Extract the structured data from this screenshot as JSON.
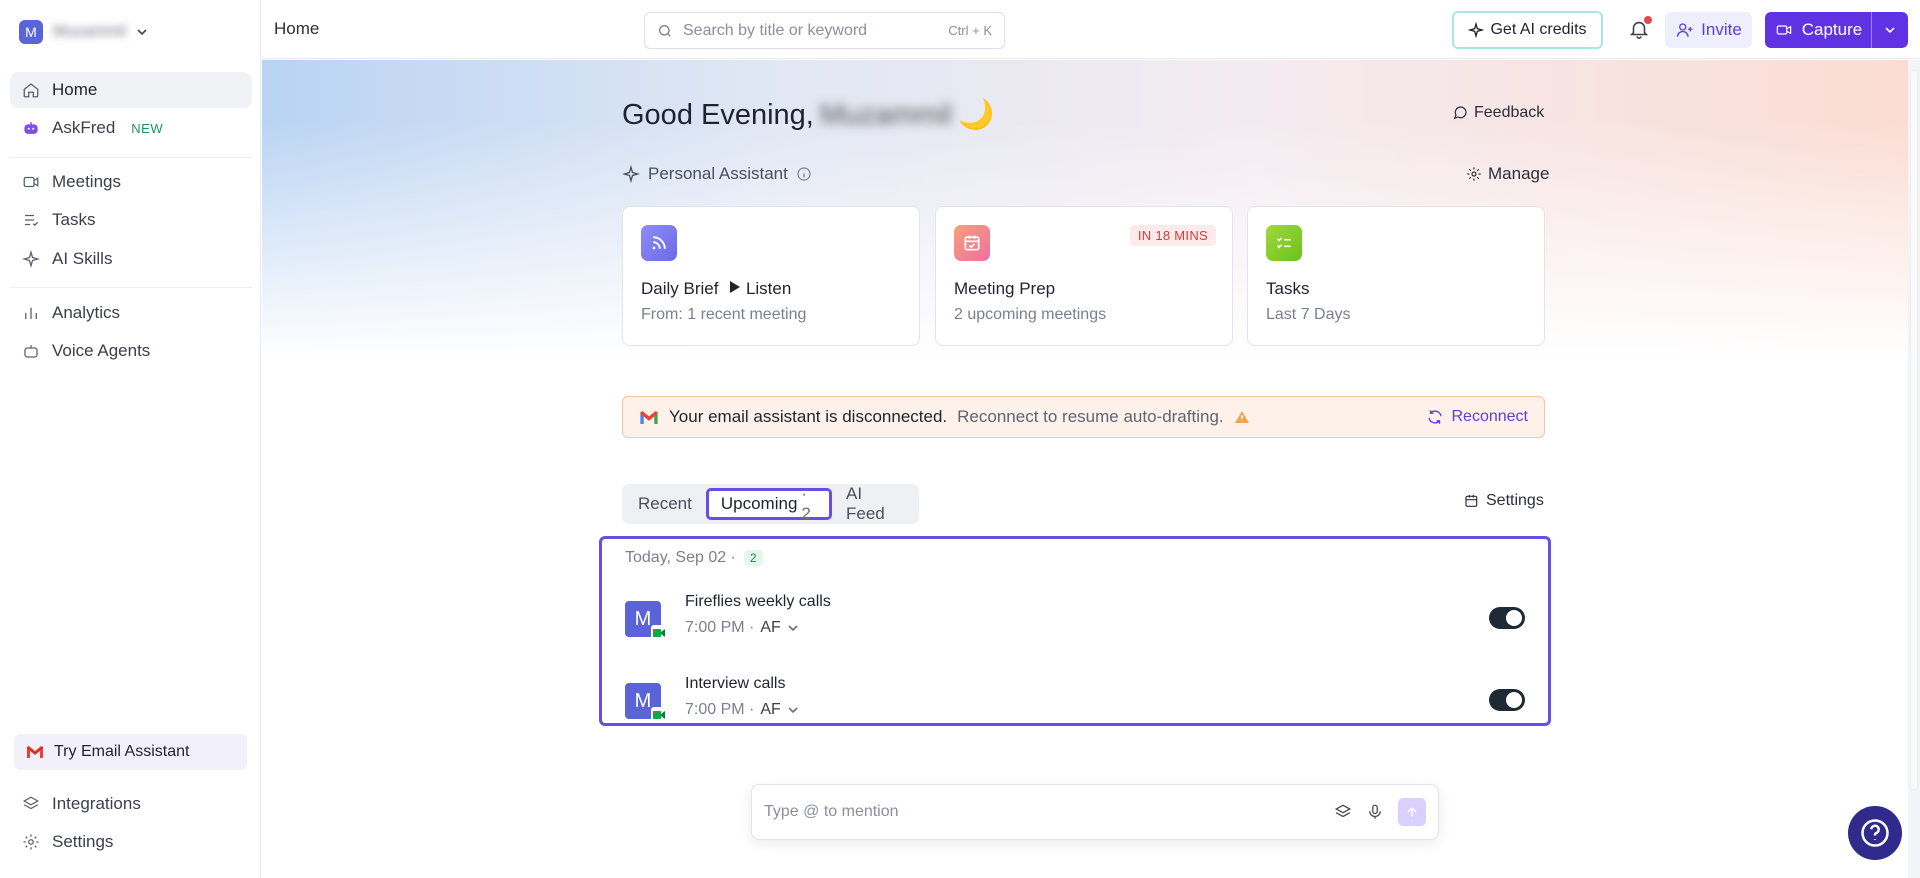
{
  "workspace": {
    "avatar_letter": "M",
    "name": "Muzammil"
  },
  "sidebar": {
    "items": [
      {
        "label": "Home"
      },
      {
        "label": "AskFred",
        "badge": "NEW"
      },
      {
        "label": "Meetings"
      },
      {
        "label": "Tasks"
      },
      {
        "label": "AI Skills"
      },
      {
        "label": "Analytics"
      },
      {
        "label": "Voice Agents"
      }
    ],
    "try_email": "Try Email Assistant",
    "bottom": [
      {
        "label": "Integrations"
      },
      {
        "label": "Settings"
      }
    ]
  },
  "header": {
    "breadcrumb": "Home",
    "search_placeholder": "Search by title or keyword",
    "search_shortcut": "Ctrl + K",
    "credits_label": "Get AI credits",
    "invite_label": "Invite",
    "capture_label": "Capture"
  },
  "main": {
    "greeting": "Good Evening,",
    "greeting_name": "Muzammil",
    "greeting_emoji": "🌙",
    "feedback_label": "Feedback",
    "assistant_label": "Personal Assistant",
    "manage_label": "Manage",
    "cards": [
      {
        "title": "Daily Brief",
        "title_extra": "Listen",
        "subtitle": "From: 1 recent meeting"
      },
      {
        "title": "Meeting Prep",
        "subtitle": "2 upcoming meetings",
        "badge": "IN 18 MINS"
      },
      {
        "title": "Tasks",
        "subtitle": "Last 7 Days"
      }
    ],
    "banner": {
      "strong": "Your email assistant is disconnected.",
      "sub": "Reconnect to resume auto-drafting.",
      "action": "Reconnect"
    },
    "tabs": [
      {
        "label": "Recent"
      },
      {
        "label": "Upcoming",
        "count": "· 2"
      },
      {
        "label": "AI Feed"
      }
    ],
    "settings_label": "Settings",
    "day_label": "Today, Sep 02 ·",
    "day_count": "2",
    "meetings": [
      {
        "avatar": "M",
        "title": "Fireflies weekly calls",
        "time": "7:00 PM ·",
        "host": "AF"
      },
      {
        "avatar": "M",
        "title": "Interview calls",
        "time": "7:00 PM ·",
        "host": "AF"
      }
    ],
    "composer_placeholder": "Type @ to mention"
  }
}
